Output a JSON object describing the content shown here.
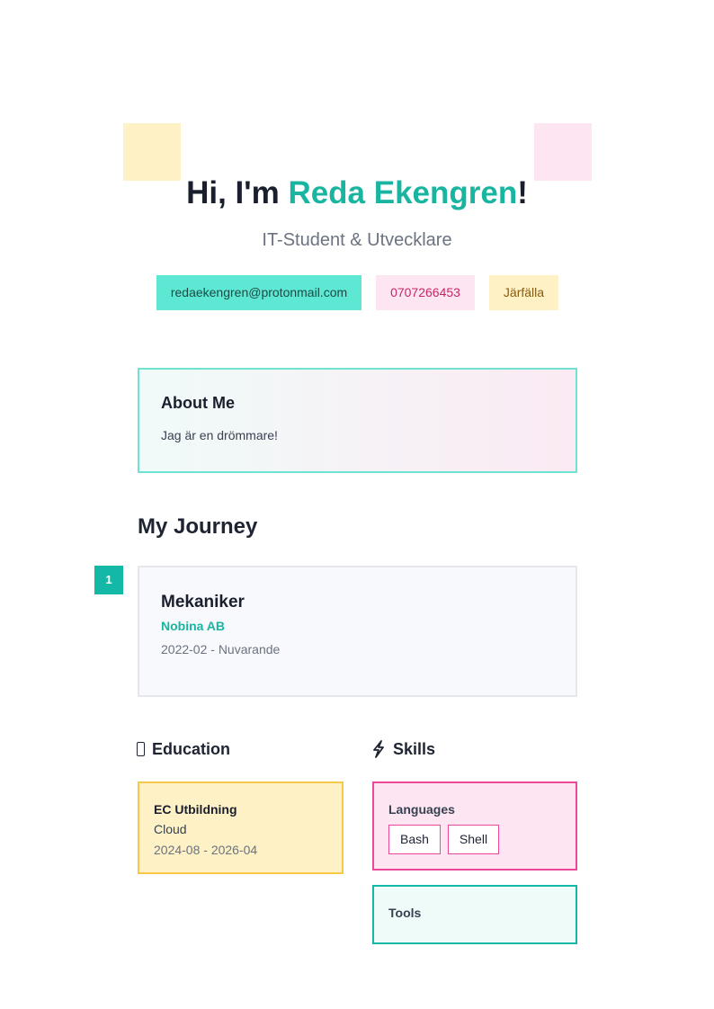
{
  "hero": {
    "greeting": "Hi, I'm ",
    "name": "Reda Ekengren",
    "exclaim": "!",
    "subtitle": "IT-Student & Utvecklare"
  },
  "contact": {
    "email": "redaekengren@protonmail.com",
    "phone": "0707266453",
    "location": "Järfälla"
  },
  "about": {
    "title": "About Me",
    "text": "Jag är en drömmare!"
  },
  "journey": {
    "title": "My Journey",
    "items": [
      {
        "number": "1",
        "role": "Mekaniker",
        "company": "Nobina AB",
        "period": "2022-02 - Nuvarande"
      }
    ]
  },
  "education": {
    "title": "Education",
    "icon": "book-icon",
    "items": [
      {
        "school": "EC Utbildning",
        "program": "Cloud",
        "dates": "2024-08 - 2026-04"
      }
    ]
  },
  "skills": {
    "title": "Skills",
    "icon": "lightning-icon",
    "languages": {
      "title": "Languages",
      "tags": [
        "Bash",
        "Shell"
      ]
    },
    "tools": {
      "title": "Tools"
    }
  },
  "colors": {
    "accent": "#19b5a0",
    "pink": "#ec4899",
    "yellow": "#f7c948"
  }
}
